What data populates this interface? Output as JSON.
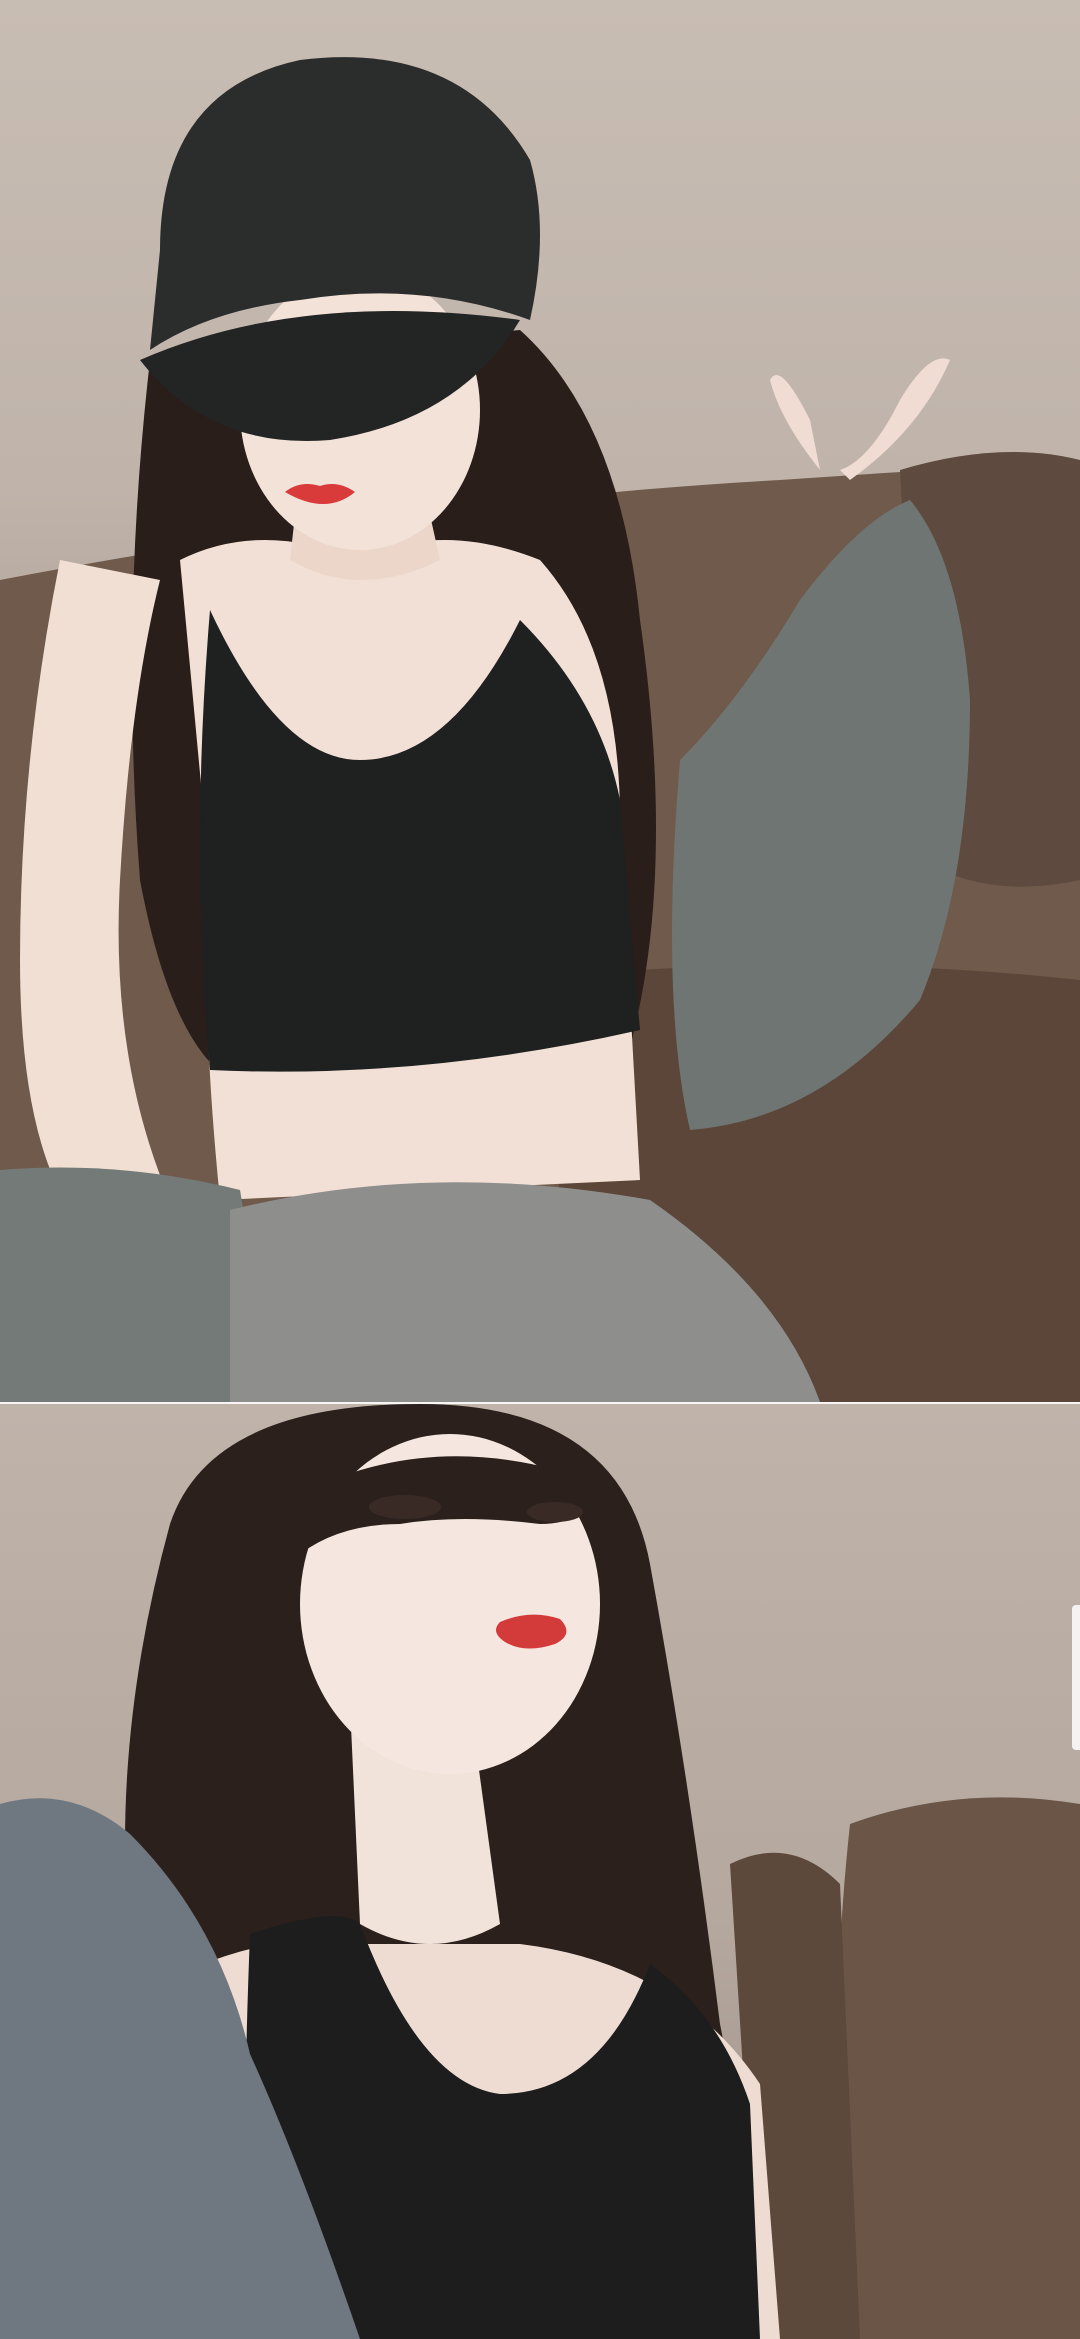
{
  "photos": [
    {
      "subject": "selfie-top",
      "description_hidden": true
    },
    {
      "subject": "selfie-bottom",
      "description_hidden": true
    }
  ],
  "colors": {
    "wall": "#c8bdb3",
    "sofa": "#6f5a4b",
    "sweater": "#737a77",
    "top_black": "#1f2020",
    "hair": "#2a1e1a",
    "skin": "#f2e0d6",
    "lips": "#d93a3a",
    "cap": "#2b2c2c"
  }
}
